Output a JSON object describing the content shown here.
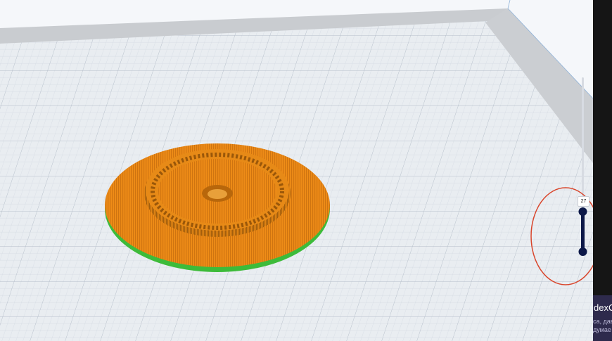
{
  "layer_slider": {
    "current_layer": "27",
    "track_color": "#0c1848",
    "rail_color": "#d7dbe2"
  },
  "highlight": {
    "color": "#d9452b"
  },
  "model": {
    "body_color": "#ef8c17",
    "edge_color": "#3dbb3a"
  },
  "promo": {
    "title": "dexC",
    "line1": "са, дав",
    "line2": "думае"
  }
}
